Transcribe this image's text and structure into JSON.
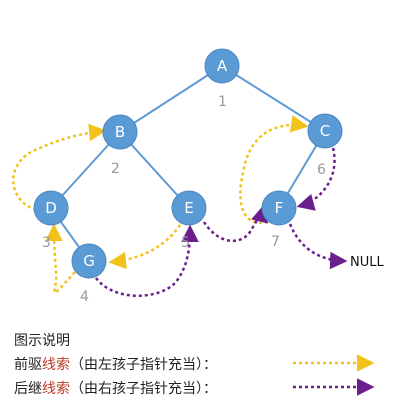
{
  "diagram": {
    "colors": {
      "node_fill": "#5b9bd5",
      "node_stroke": "#4a86bf",
      "edge": "#5b9bd5",
      "predecessor_thread": "#f2c21b",
      "successor_thread": "#6b1f8f"
    },
    "nodes": [
      {
        "id": "A",
        "label": "A",
        "seq": "1"
      },
      {
        "id": "B",
        "label": "B",
        "seq": "2"
      },
      {
        "id": "C",
        "label": "C",
        "seq": "6"
      },
      {
        "id": "D",
        "label": "D",
        "seq": "3"
      },
      {
        "id": "E",
        "label": "E",
        "seq": "5"
      },
      {
        "id": "F",
        "label": "F",
        "seq": "7"
      },
      {
        "id": "G",
        "label": "G",
        "seq": "4"
      }
    ],
    "edges": [
      [
        "A",
        "B"
      ],
      [
        "A",
        "C"
      ],
      [
        "B",
        "D"
      ],
      [
        "B",
        "E"
      ],
      [
        "C",
        "F"
      ],
      [
        "D",
        "G"
      ]
    ],
    "predecessor_threads": [
      [
        "D",
        "B"
      ],
      [
        "G",
        "D"
      ],
      [
        "E",
        "G"
      ],
      [
        "F",
        "C"
      ]
    ],
    "successor_threads": [
      [
        "G",
        "E"
      ],
      [
        "E",
        "F"
      ],
      [
        "C",
        "F"
      ],
      [
        "F",
        "NULL"
      ]
    ],
    "null_label": "NULL"
  },
  "legend": {
    "title": "图示说明",
    "predecessor": {
      "prefix": "前驱",
      "red": "线索",
      "suffix": "（由左孩子指针充当）："
    },
    "successor": {
      "prefix": "后继",
      "red": "线索",
      "suffix": "（由右孩子指针充当）："
    }
  }
}
